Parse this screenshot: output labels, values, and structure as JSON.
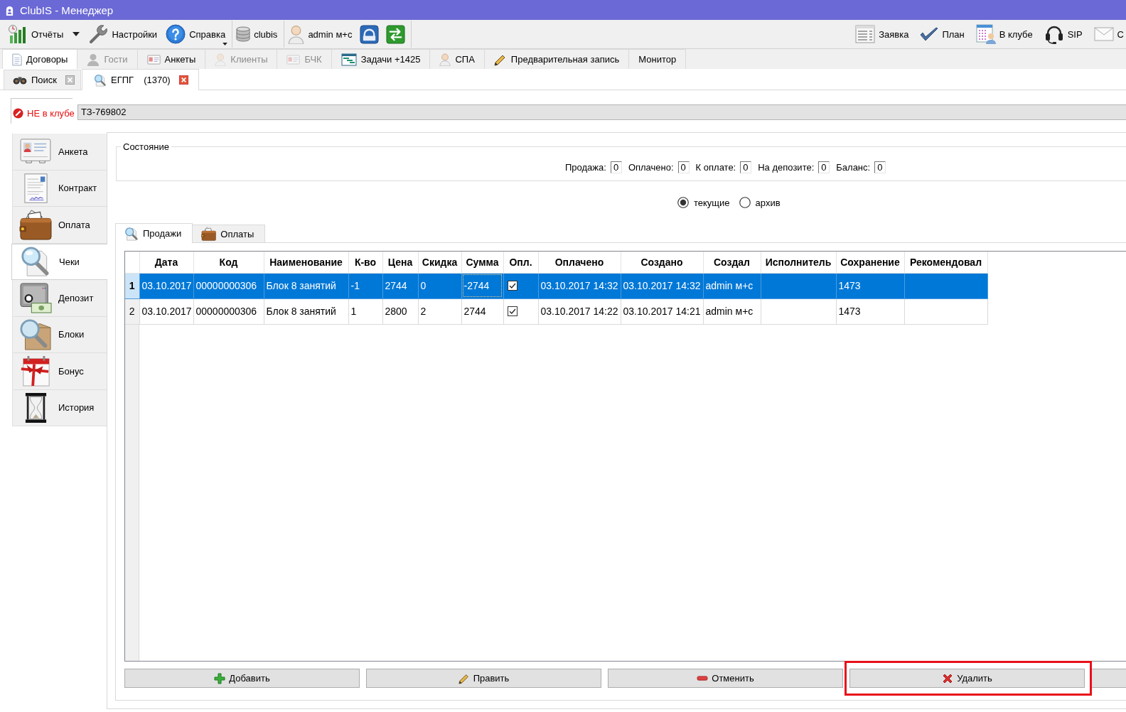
{
  "window": {
    "title": "ClubIS - Менеджер"
  },
  "toolbar": {
    "groups": [
      {
        "items": [
          {
            "kind": "split",
            "label": "Отчёты"
          },
          {
            "kind": "button",
            "label": "Настройки"
          },
          {
            "kind": "menu",
            "label": "Справка"
          }
        ]
      },
      {
        "items": [
          {
            "kind": "button",
            "label": "clubis"
          }
        ]
      },
      {
        "items": [
          {
            "kind": "button",
            "label": "admin м+с"
          },
          {
            "kind": "icon"
          },
          {
            "kind": "icon"
          }
        ]
      }
    ],
    "right": [
      {
        "label": "Заявка"
      },
      {
        "label": "План"
      },
      {
        "label": "В клубе"
      },
      {
        "label": "SIP"
      },
      {
        "label": "С"
      }
    ]
  },
  "main_tabs": [
    {
      "label": "Договоры",
      "selected": true,
      "disabled": false
    },
    {
      "label": "Гости",
      "selected": false,
      "disabled": true
    },
    {
      "label": "Анкеты",
      "selected": false,
      "disabled": false
    },
    {
      "label": "Клиенты",
      "selected": false,
      "disabled": true
    },
    {
      "label": "БЧК",
      "selected": false,
      "disabled": true
    },
    {
      "label": "Задачи +1425",
      "selected": false,
      "disabled": false
    },
    {
      "label": "СПА",
      "selected": false,
      "disabled": false
    },
    {
      "label": "Предварительная запись",
      "selected": false,
      "disabled": false
    },
    {
      "label": "Монитор",
      "selected": false,
      "disabled": false
    }
  ],
  "sub_tabs": [
    {
      "label": "Поиск",
      "selected": false
    },
    {
      "label": "ЕГПГ",
      "count": "(1370)",
      "selected": true
    }
  ],
  "client": {
    "status": "НЕ в клубе",
    "in_club": false,
    "card": "ТЗ-769802"
  },
  "sidebar": {
    "items": [
      {
        "label": "Анкета",
        "selected": false
      },
      {
        "label": "Контракт",
        "selected": false
      },
      {
        "label": "Оплата",
        "selected": false
      },
      {
        "label": "Чеки",
        "selected": true
      },
      {
        "label": "Депозит",
        "selected": false
      },
      {
        "label": "Блоки",
        "selected": false
      },
      {
        "label": "Бонус",
        "selected": false
      },
      {
        "label": "История",
        "selected": false
      }
    ]
  },
  "summary": {
    "title": "Состояние",
    "fields": [
      {
        "label": "Продажа:",
        "value": "0"
      },
      {
        "label": "Оплачено:",
        "value": "0"
      },
      {
        "label": "К оплате:",
        "value": "0"
      },
      {
        "label": "На депозите:",
        "value": "0"
      },
      {
        "label": "Баланс:",
        "value": "0"
      }
    ]
  },
  "filter": [
    {
      "label": "текущие",
      "selected": true
    },
    {
      "label": "архив",
      "selected": false
    }
  ],
  "inner_tabs": [
    {
      "label": "Продажи",
      "selected": true
    },
    {
      "label": "Оплаты",
      "selected": false
    }
  ],
  "table": {
    "columns": [
      {
        "label": "Дата",
        "kind": "text"
      },
      {
        "label": "Код",
        "kind": "text"
      },
      {
        "label": "Наименование",
        "kind": "text"
      },
      {
        "label": "К-во",
        "kind": "text"
      },
      {
        "label": "Цена",
        "kind": "text"
      },
      {
        "label": "Скидка",
        "kind": "text"
      },
      {
        "label": "Сумма",
        "kind": "text"
      },
      {
        "label": "Опл.",
        "kind": "check"
      },
      {
        "label": "Оплачено",
        "kind": "text"
      },
      {
        "label": "Создано",
        "kind": "text"
      },
      {
        "label": "Создал",
        "kind": "text"
      },
      {
        "label": "Исполнитель",
        "kind": "text"
      },
      {
        "label": "Сохранение",
        "kind": "text"
      },
      {
        "label": "Рекомендовал",
        "kind": "text"
      }
    ],
    "rows": [
      {
        "number": "1",
        "selected": true,
        "cells": [
          {
            "text": "03.10.2017",
            "focused": false
          },
          {
            "text": "00000000306",
            "focused": false
          },
          {
            "text": "Блок 8 занятий",
            "focused": false
          },
          {
            "text": "-1",
            "focused": false
          },
          {
            "text": "2744",
            "focused": false
          },
          {
            "text": "0",
            "focused": false
          },
          {
            "text": "-2744",
            "focused": true
          },
          {
            "checked": true,
            "focused": false
          },
          {
            "text": "03.10.2017 14:32",
            "focused": false
          },
          {
            "text": "03.10.2017 14:32",
            "focused": false
          },
          {
            "text": "admin м+с",
            "focused": false
          },
          {
            "focused": false
          },
          {
            "text": "1473",
            "focused": false
          },
          {
            "focused": false
          }
        ]
      },
      {
        "number": "2",
        "selected": false,
        "cells": [
          {
            "text": "03.10.2017",
            "focused": false
          },
          {
            "text": "00000000306",
            "focused": false
          },
          {
            "text": "Блок 8 занятий",
            "focused": false
          },
          {
            "text": "1",
            "focused": false
          },
          {
            "text": "2800",
            "focused": false
          },
          {
            "text": "2",
            "focused": false
          },
          {
            "text": "2744",
            "focused": false
          },
          {
            "checked": true,
            "focused": false
          },
          {
            "text": "03.10.2017 14:22",
            "focused": false
          },
          {
            "text": "03.10.2017 14:21",
            "focused": false
          },
          {
            "text": "admin м+с",
            "focused": false
          },
          {
            "focused": false
          },
          {
            "text": "1473",
            "focused": false
          },
          {
            "focused": false
          }
        ]
      }
    ]
  },
  "buttons": [
    {
      "kind": "labeled",
      "label": "Добавить",
      "highlighted": false
    },
    {
      "kind": "labeled",
      "label": "Править",
      "highlighted": false
    },
    {
      "kind": "labeled",
      "label": "Отменить",
      "highlighted": false
    },
    {
      "kind": "labeled",
      "label": "Удалить",
      "highlighted": true
    },
    {
      "kind": "cut_off",
      "highlighted": false
    }
  ]
}
